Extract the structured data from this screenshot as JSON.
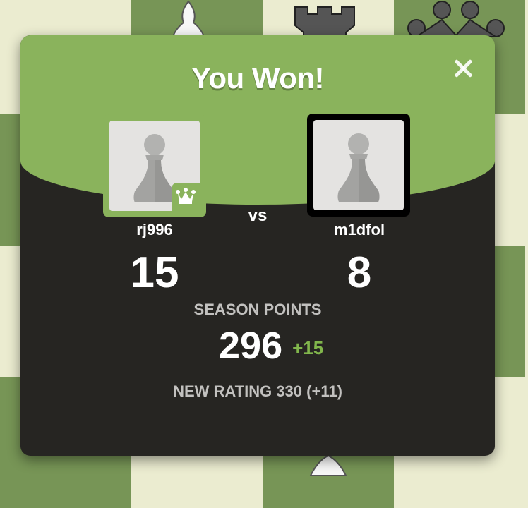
{
  "modal": {
    "title": "You Won!",
    "vs_label": "vs",
    "close_icon": "close-icon"
  },
  "players": {
    "winner": {
      "username": "rj996",
      "score": "15",
      "avatar_icon": "pawn-icon",
      "badge_icon": "crown-icon"
    },
    "loser": {
      "username": "m1dfol",
      "score": "8",
      "avatar_icon": "pawn-icon"
    }
  },
  "season": {
    "label": "SEASON POINTS",
    "points": "296",
    "delta": "+15"
  },
  "rating": {
    "text": "NEW RATING 330 (+11)"
  },
  "colors": {
    "accent_green": "#8ab35c",
    "delta_green": "#81b64c",
    "modal_dark": "#262522",
    "board_light": "#ebecd0",
    "board_dark": "#779556"
  }
}
